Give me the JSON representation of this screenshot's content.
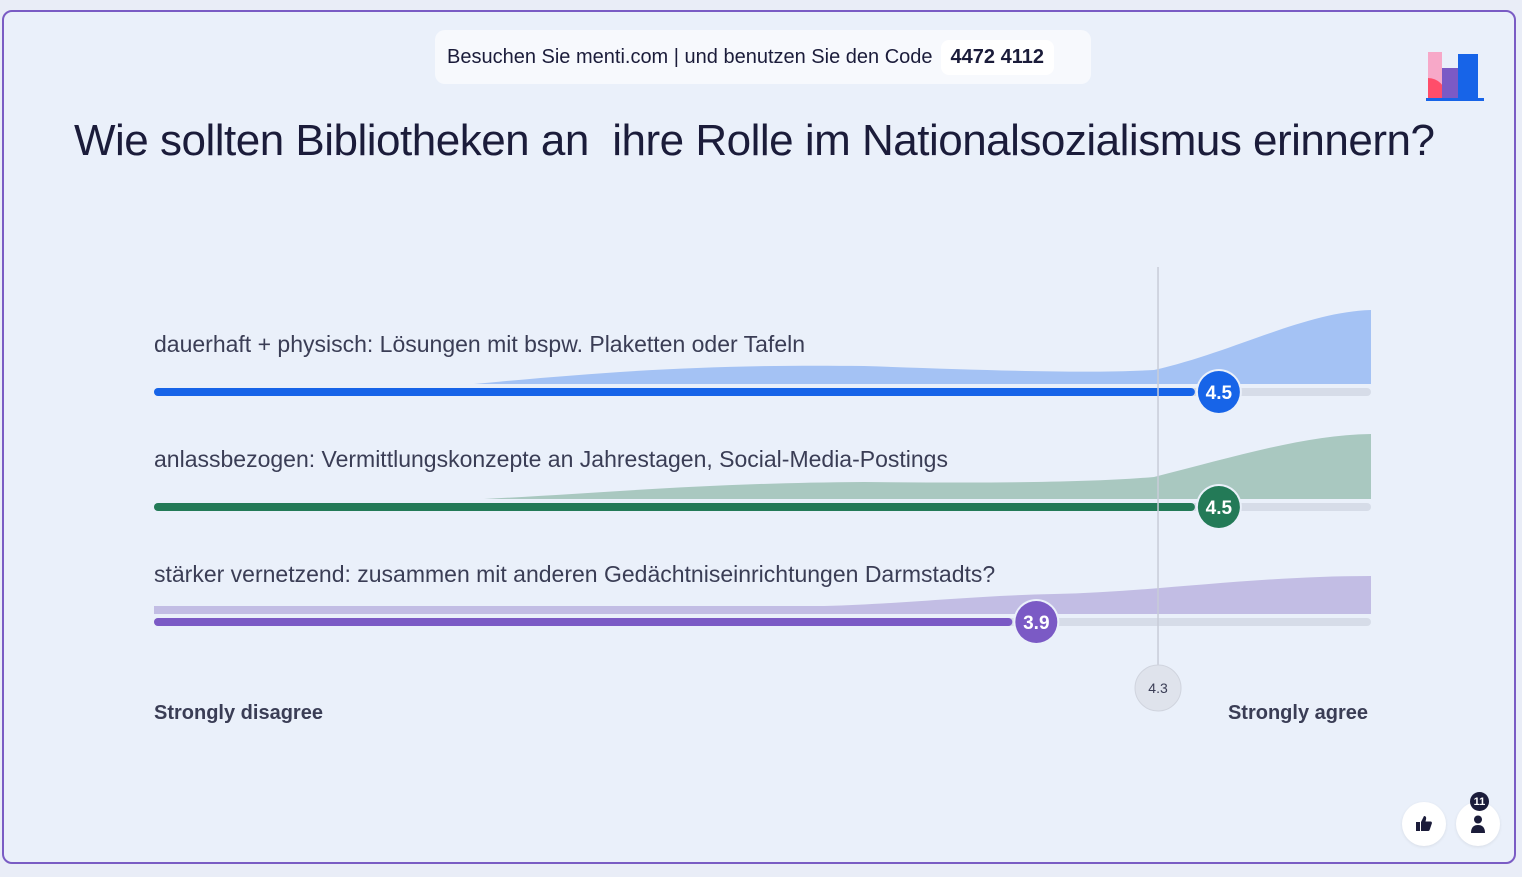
{
  "join_banner": {
    "instruction": "Besuchen Sie menti.com | und benutzen Sie den Code",
    "code": "4472 4112"
  },
  "question": {
    "title": "Wie sollten Bibliotheken an  ihre Rolle im Nationalsozialismus erinnern?"
  },
  "chart_data": {
    "type": "scale",
    "scale_min": 1,
    "scale_max": 5,
    "min_label": "Strongly disagree",
    "max_label": "Strongly agree",
    "overall_average": 4.3,
    "overall_average_label": "4.3",
    "series": [
      {
        "name": "dauerhaft + physisch: Lösungen mit bspw. Plaketten oder Tafeln",
        "value": 4.5,
        "value_label": "4.5",
        "color": "#1764e8",
        "area_color": "#a4c2f4"
      },
      {
        "name": "anlassbezogen: Vermittlungskonzepte an Jahrestagen, Social-Media-Postings",
        "value": 4.5,
        "value_label": "4.5",
        "color": "#237a57",
        "area_color": "#a9c8c0"
      },
      {
        "name": "stärker vernetzend: zusammen mit anderen Gedächtniseinrichtungen Darmstadts?",
        "value": 3.9,
        "value_label": "3.9",
        "color": "#7b5ac5",
        "area_color": "#c2bde4"
      }
    ]
  },
  "footer": {
    "participants_count": "11",
    "reactions_icon": "thumbs-up-icon",
    "participants_icon": "person-icon"
  },
  "colors": {
    "frame_border": "#7a5cc4",
    "background": "#eaf0fa",
    "track": "#d6dce8"
  }
}
